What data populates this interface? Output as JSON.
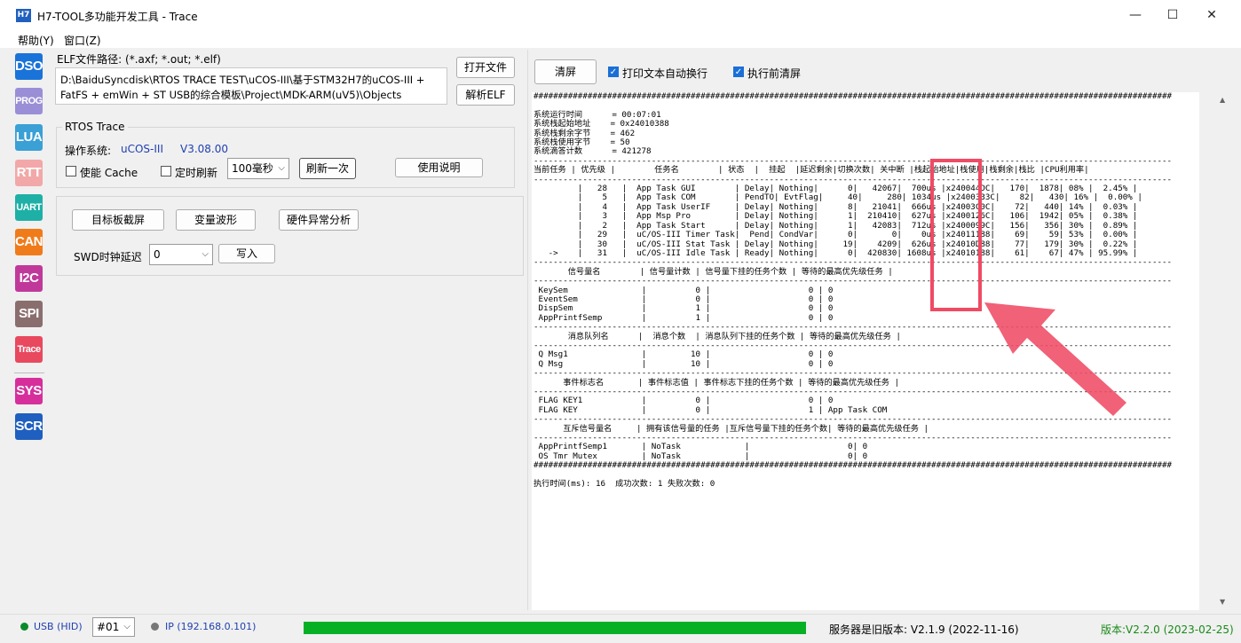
{
  "window": {
    "icon_text": "H7",
    "title": "H7-TOOL多功能开发工具 - Trace",
    "minimize": "—",
    "maximize": "☐",
    "close": "✕"
  },
  "menu": [
    "帮助(Y)",
    "窗口(Z)"
  ],
  "tools": [
    {
      "label": "DSO",
      "color": "#1a73d9"
    },
    {
      "label": "PROG",
      "color": "#9a8fd6"
    },
    {
      "label": "LUA",
      "color": "#3aa0d6"
    },
    {
      "label": "RTT",
      "color": "#f2a8a8"
    },
    {
      "label": "UART",
      "color": "#1eb0a6"
    },
    {
      "label": "CAN",
      "color": "#f07b1a"
    },
    {
      "label": "I2C",
      "color": "#c0399a"
    },
    {
      "label": "SPI",
      "color": "#8a6e6e"
    },
    {
      "label": "Trace",
      "color": "#e8495f"
    },
    {
      "label": "SYS",
      "color": "#d62f9c"
    },
    {
      "label": "SCR",
      "color": "#1f5fbf"
    }
  ],
  "elf": {
    "label": "ELF文件路径: (*.axf; *.out; *.elf)",
    "path_line1": "D:\\BaiduSyncdisk\\RTOS TRACE TEST\\uCOS-III\\基于STM32H7的uCOS-III +",
    "path_line2": "FatFS + emWin + ST USB的综合模板\\Project\\MDK-ARM(uV5)\\Objects",
    "open_btn": "打开文件",
    "parse_btn": "解析ELF"
  },
  "rtos": {
    "group_title": "RTOS Trace",
    "os_label": "操作系统:",
    "os_name": "uCOS-III",
    "os_version": "V3.08.00",
    "cache_label": "使能 Cache",
    "timer_label": "定时刷新",
    "interval": "100毫秒",
    "refresh_btn": "刷新一次",
    "help_btn": "使用说明"
  },
  "tools2": {
    "screenshot_btn": "目标板截屏",
    "wave_btn": "变量波形",
    "fault_btn": "硬件异常分析",
    "swd_label": "SWD时钟延迟",
    "swd_value": "0",
    "write_btn": "写入"
  },
  "toolbar": {
    "clear_btn": "清屏",
    "wrap_label": "打印文本自动换行",
    "clear_before_label": "执行前清屏"
  },
  "output_lines": [
    "##################################################################################################################################",
    "",
    "系统运行时间      = 00:07:01",
    "系统栈起始地址    = 0x24010388",
    "系统栈剩余字节    = 462",
    "系统栈使用字节    = 50",
    "系统滴答计数      = 421278",
    "----------------------------------------------------------------------------------------------------------------------------------",
    "当前任务 | 优先级 |        任务名        | 状态  |  挂起  |延迟剩余|切换次数| 关中断 |栈起始地址|栈使用|栈剩余|栈比 |CPU利用率|",
    "----------------------------------------------------------------------------------------------------------------------------------",
    "         |   28   |  App Task GUI        | Delay| Nothing|      0|   42067|  700us |x240044DC|   170|  1878| 08% |  2.45% |",
    "         |    5   |  App Task COM        | PendTO| EvtFlag|     40|     280| 1034us |x2400333C|    82|   430| 16% |  0.00% |",
    "         |    4   |  App Task UserIF     | Delay| Nothing|      8|   21041|  666us |x24003C0C|    72|   440| 14% |  0.03% |",
    "         |    3   |  App Msp Pro         | Delay| Nothing|      1|  210410|  627us |x2400126C|   106|  1942| 05% |  0.38% |",
    "         |    2   |  App Task Start      | Delay| Nothing|      1|   42083|  712us |x2400099C|   156|   356| 30% |  0.89% |",
    "         |   29   |  uC/OS-III Timer Task|  Pend| CondVar|      0|       0|    0us |x24011188|    69|    59| 53% |  0.00% |",
    "         |   30   |  uC/OS-III Stat Task | Delay| Nothing|     19|    4209|  626us |x24010D88|    77|   179| 30% |  0.22% |",
    "   ->    |   31   |  uC/OS-III Idle Task | Ready| Nothing|      0|  420830| 1608us |x24010188|    61|    67| 47% | 95.99% |",
    "----------------------------------------------------------------------------------------------------------------------------------",
    "       信号量名        | 信号量计数 | 信号量下挂的任务个数 | 等待的最高优先级任务 |",
    "----------------------------------------------------------------------------------------------------------------------------------",
    " KeySem               |          0 |                    0 | 0",
    " EventSem             |          0 |                    0 | 0",
    " DispSem              |          1 |                    0 | 0",
    " AppPrintfSemp        |          1 |                    0 | 0",
    "----------------------------------------------------------------------------------------------------------------------------------",
    "       消息队列名      |  消息个数  | 消息队列下挂的任务个数 | 等待的最高优先级任务 |",
    "----------------------------------------------------------------------------------------------------------------------------------",
    " Q Msg1               |         10 |                    0 | 0",
    " Q Msg                |         10 |                    0 | 0",
    "----------------------------------------------------------------------------------------------------------------------------------",
    "      事件标志名       | 事件标志值 | 事件标志下挂的任务个数 | 等待的最高优先级任务 |",
    "----------------------------------------------------------------------------------------------------------------------------------",
    " FLAG KEY1            |          0 |                    0 | 0",
    " FLAG KEY             |          0 |                    1 | App Task COM",
    "----------------------------------------------------------------------------------------------------------------------------------",
    "      互斥信号量名     | 拥有该信号量的任务 |互斥信号量下挂的任务个数| 等待的最高优先级任务 |",
    "----------------------------------------------------------------------------------------------------------------------------------",
    " AppPrintfSemp1       | NoTask             |                    0| 0",
    " OS Tmr Mutex         | NoTask             |                    0| 0",
    "##################################################################################################################################",
    "",
    "执行时间(ms): 16  成功次数: 1 失败次数: 0"
  ],
  "status": {
    "usb_label": "USB (HID)",
    "usb_color": "#0a8a2a",
    "device_id": "#01",
    "ip_label": "IP (192.168.0.101)",
    "ip_color": "#777777",
    "progress": 1.0,
    "server_text": "服务器是旧版本: V2.1.9 (2022-11-16)",
    "version_text": "版本:V2.2.0 (2023-02-25)"
  }
}
